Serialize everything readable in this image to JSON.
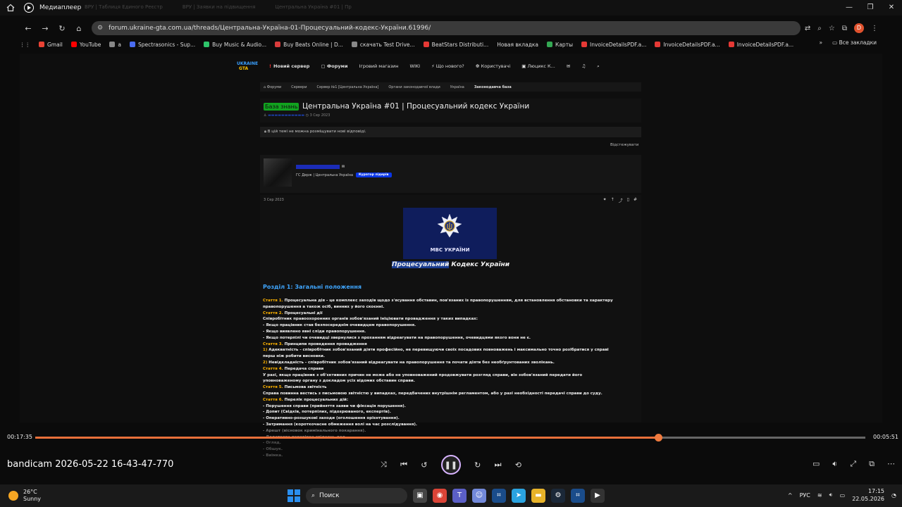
{
  "window": {
    "app_title": "Медиаплеер",
    "ghost_tabs": [
      "ВРУ | Таблиця Единого Реєстр",
      "ВРУ | Заявки на підвищення",
      "Центральна Україна #01 | Пр"
    ],
    "controls": [
      "—",
      "❐",
      "✕"
    ]
  },
  "browser": {
    "url": "forum.ukraine-gta.com.ua/threads/Центральна-Україна-01-Процесуальний-кодекс-України.61996/",
    "profile_initial": "D",
    "bookmarks": [
      {
        "label": "Gmail",
        "color": "#ea4335"
      },
      {
        "label": "YouTube",
        "color": "#ff0000"
      },
      {
        "label": "a",
        "color": "#888888"
      },
      {
        "label": "Spectrasonics - Sup...",
        "color": "#4a6cf0"
      },
      {
        "label": "Buy Music & Audio...",
        "color": "#2ec46a"
      },
      {
        "label": "Buy Beats Online | D...",
        "color": "#d93c3c"
      },
      {
        "label": "скачать Test Drive...",
        "color": "#888888"
      },
      {
        "label": "BeatStars Distributi...",
        "color": "#e53935"
      },
      {
        "label": "Новая вкладка",
        "color": ""
      },
      {
        "label": "Карты",
        "color": "#34a853"
      },
      {
        "label": "InvoiceDetailsPDF.a...",
        "color": "#e53935"
      },
      {
        "label": "InvoiceDetailsPDF.a...",
        "color": "#e53935"
      },
      {
        "label": "InvoiceDetailsPDF.a...",
        "color": "#e53935"
      }
    ],
    "all_bookmarks": "Все закладки"
  },
  "forum": {
    "logo_top": "UKRAINE",
    "logo_bottom": "GTA",
    "nav": [
      "Новий сервер",
      "Форуми",
      "Ігровий магазин",
      "WIKI",
      "Що нового?",
      "Користувачі",
      "Люцикс К..."
    ],
    "breadcrumbs": [
      "Форуми",
      "Сервери",
      "Сервер №1 [Центральна Україна]",
      "Органи законодавчої влади",
      "Україна",
      "Законодавча база"
    ],
    "thread_badge": "База знань",
    "thread_title": "Центральна Україна #01 | Процесуальний кодекс України",
    "thread_date": "3 Сер 2023",
    "closed_notice": "В цій темі не можна розміщувати нові відповіді.",
    "watch_label": "Відстежувати",
    "user_role": "ГС Держ | Центральна Україна",
    "user_badge": "Куратор лідерів",
    "post_date": "3 Сер 2023"
  },
  "post": {
    "emblem_caption": "МВС УКРАЇНИ",
    "kodex_highlight": "Процесуальний",
    "kodex_rest": " Кодекс України",
    "section_title": "Розділ 1: Загальні положення",
    "lines": [
      {
        "label": "Стаття 1.",
        "text": " Процесуальна дія - це комплекс заходів щодо з'ясування обставин, пов'язаних із правопорушенням, для встановлення обстановки та характеру"
      },
      {
        "label": "",
        "text": "правопорушення а також осіб, винних у його скоєнні."
      },
      {
        "label": "Стаття 2.",
        "text": " Процесуальні дії"
      },
      {
        "label": "",
        "text": "Співробітник правоохоронних органів зобов'язаний ініціювати провадження у таких випадках:"
      },
      {
        "label": "",
        "text": "- Якщо працівник став безпосереднім очевидцем правопорушення."
      },
      {
        "label": "",
        "text": "- Якщо виявлено явні сліди правопорушення."
      },
      {
        "label": "",
        "text": "- Якщо потерпілі чи очевидці звернулися з проханням відреагувати на правопорушення, очевидцями якого вони не є."
      },
      {
        "label": "Стаття 3.",
        "text": " Принципи проведення провадження"
      },
      {
        "label": "1)",
        "text": " Адекватність - співробітник зобов'язаний діяти професійно, не перевищуючи своїх посадових повноважень і максимально точно розібратися у справі"
      },
      {
        "label": "",
        "text": "перш ніж робити висновки."
      },
      {
        "label": "2)",
        "text": " Невідкладність - співробітник зобов'язаний відреагувати на правопорушення та почати діяти без необґрунтованих зволікань."
      },
      {
        "label": "Стаття 4.",
        "text": " Передача справи"
      },
      {
        "label": "",
        "text": "У разі, якщо працівник з об'єктивних причин не може або не уповноважений продовжувати розгляд справи, він зобов'язаний передати його"
      },
      {
        "label": "",
        "text": "уповноваженому органу з докладом усіх відомих обставин справи."
      },
      {
        "label": "Стаття 5.",
        "text": " Письмова звітність"
      },
      {
        "label": "",
        "text": "Справа повинна вестись з письмовою звітністю у випадках, передбачених внутрішнім регламентом, або у разі необхідності передачі справи до суду."
      },
      {
        "label": "Стаття 6.",
        "text": " Перелік процесуальних дій:"
      },
      {
        "label": "",
        "text": "- Порушення справи (прийняття заяви чи фіксація порушення)."
      },
      {
        "label": "",
        "text": "- Допит (Свідків, потерпілих, підозрюваного, експертів)."
      },
      {
        "label": "",
        "text": "- Оперативно-розшукові заходи (оголошення орієнтування)."
      },
      {
        "label": "",
        "text": "- Затримання (короткочасне обмеження волі на час розслідування)."
      },
      {
        "label": "",
        "text": "- Арешт (вісновок кримінального покарання)."
      },
      {
        "label": "",
        "text": "- Додаткова перевірка свідчень дол"
      },
      {
        "label": "",
        "text": "- Огляд."
      },
      {
        "label": "",
        "text": "- Обшук."
      },
      {
        "label": "",
        "text": "- Виїмка."
      }
    ]
  },
  "player": {
    "elapsed": "00:17:35",
    "remaining": "00:05:51",
    "progress": 0.75,
    "caption": "bandicam 2026-05-22 16-43-47-770",
    "accent": "#e8703a"
  },
  "taskbar": {
    "temp": "26°C",
    "condition": "Sunny",
    "search_label": "Поиск",
    "lang": "РУС",
    "time": "17:15",
    "date": "22.05.2026"
  }
}
